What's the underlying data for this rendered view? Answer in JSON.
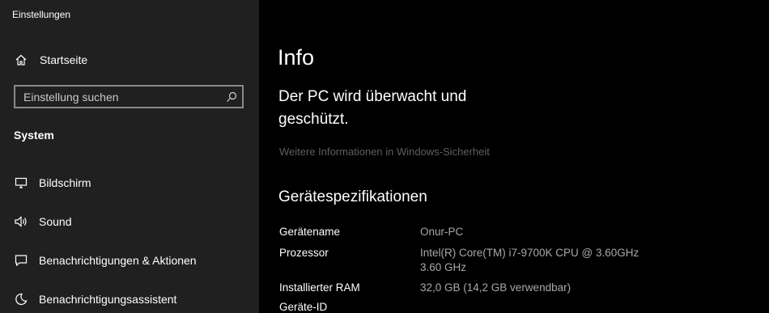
{
  "window": {
    "title": "Einstellungen"
  },
  "sidebar": {
    "home_label": "Startseite",
    "search": {
      "placeholder": "Einstellung suchen",
      "value": ""
    },
    "section_header": "System",
    "items": [
      {
        "label": "Bildschirm",
        "icon": "monitor-icon"
      },
      {
        "label": "Sound",
        "icon": "speaker-icon"
      },
      {
        "label": "Benachrichtigungen & Aktionen",
        "icon": "notification-icon"
      },
      {
        "label": "Benachrichtigungsassistent",
        "icon": "moon-icon"
      }
    ]
  },
  "main": {
    "title": "Info",
    "protection_status": "Der PC wird überwacht und geschützt.",
    "security_link": "Weitere Informationen in Windows-Sicherheit",
    "specs_heading": "Gerätespezifikationen",
    "specs": [
      {
        "label": "Gerätename",
        "value": "Onur-PC"
      },
      {
        "label": "Prozessor",
        "value": "Intel(R) Core(TM) i7-9700K CPU @ 3.60GHz",
        "value2": "3.60 GHz"
      },
      {
        "label": "Installierter RAM",
        "value": "32,0 GB (14,2 GB verwendbar)"
      },
      {
        "label": "Geräte-ID",
        "value": ""
      }
    ]
  },
  "colors": {
    "sidebar_bg": "#202020",
    "main_bg": "#000000",
    "text": "#ffffff",
    "secondary_text": "#a8a8a8",
    "link_disabled": "#5f5f5f"
  }
}
